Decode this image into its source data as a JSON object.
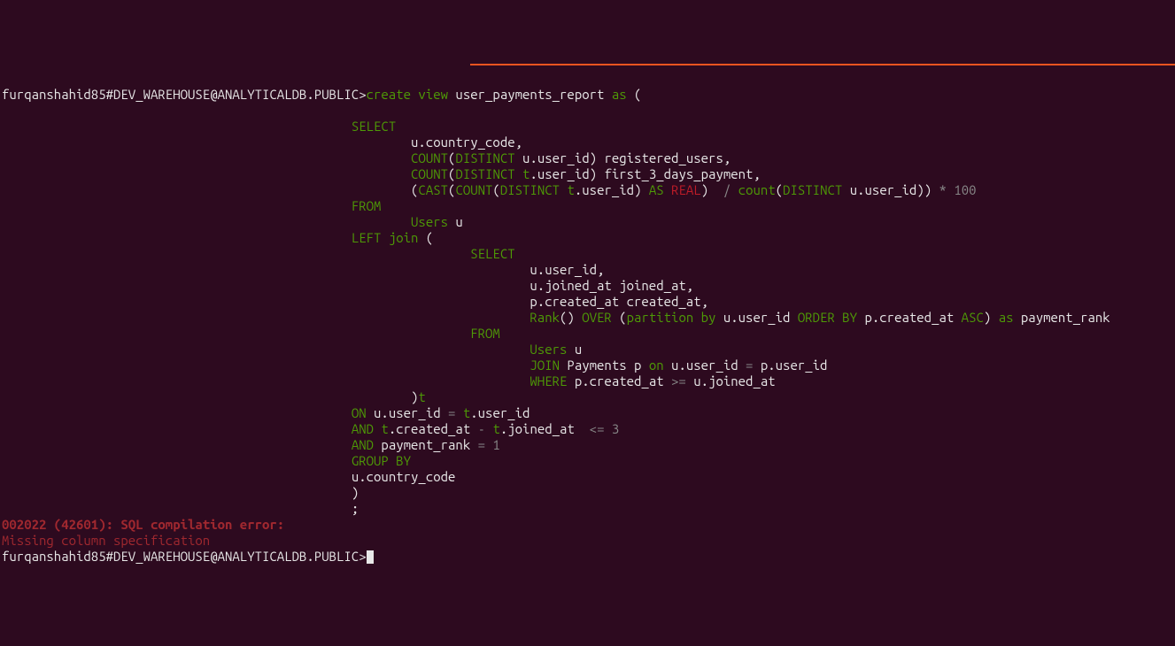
{
  "terminal": {
    "prompt": "furqanshahid85#DEV_WAREHOUSE@ANALYTICALDB.PUBLIC>",
    "prompt2": "furqanshahid85#DEV_WAREHOUSE@ANALYTICALDB.PUBLIC>",
    "sql": {
      "l1_kw": "create view",
      "l1_ident": " user_payments_report ",
      "l1_as": "as",
      "l1_paren": " (",
      "l3_select": "SELECT",
      "l4": "u.country_code,",
      "l5_count": "COUNT",
      "l5_p1": "(",
      "l5_dist": "DISTINCT",
      "l5_rest": " u.user_id) registered_users,",
      "l6_count": "COUNT",
      "l6_p1": "(",
      "l6_dist": "DISTINCT",
      "l6_t": " t",
      "l6_rest": ".user_id) first_3_days_payment,",
      "l7_p1": "(",
      "l7_cast": "CAST",
      "l7_p2": "(",
      "l7_count": "COUNT",
      "l7_p3": "(",
      "l7_dist": "DISTINCT",
      "l7_t": " t",
      "l7_uid": ".user_id)",
      "l7_as": " AS",
      "l7_real": " REAL",
      "l7_close": ")  ",
      "l7_div": "/",
      "l7_count2": " count",
      "l7_p4": "(",
      "l7_dist2": "DISTINCT",
      "l7_rest": " u.user_id)) ",
      "l7_mul": "*",
      "l7_num": " 100",
      "l8_from": "FROM",
      "l9_users": "Users",
      "l9_u": " u",
      "l10_left": "LEFT",
      "l10_join": " join",
      "l10_paren": " (",
      "l11_select": "SELECT",
      "l12": "u.user_id,",
      "l13": "u.joined_at joined_at,",
      "l14": "p.created_at created_at,",
      "l15_rank": "Rank",
      "l15_p1": "() ",
      "l15_over": "OVER",
      "l15_p2": " (",
      "l15_part": "partition by",
      "l15_uid": " u.user_id ",
      "l15_order": "ORDER BY",
      "l15_pc": " p.created_at ",
      "l15_asc": "ASC",
      "l15_close": ") ",
      "l15_as": "as",
      "l15_pr": " payment_rank",
      "l16_from": "FROM",
      "l17_users": "Users",
      "l17_u": " u",
      "l18_join": "JOIN",
      "l18_pay": " Payments p ",
      "l18_on": "on",
      "l18_cond": " u.user_id ",
      "l18_eq": "=",
      "l18_cond2": " p.user_id",
      "l19_where": "WHERE",
      "l19_p": " p.created_at ",
      "l19_ge": ">=",
      "l19_u": " u.joined_at",
      "l20_close": ")",
      "l20_t": "t",
      "l21_on": "ON",
      "l21_u": " u.user_id ",
      "l21_eq": "=",
      "l21_t": " t",
      "l21_uid": ".user_id",
      "l22_and": "AND",
      "l22_t1": " t",
      "l22_ca": ".created_at ",
      "l22_minus": "-",
      "l22_t2": " t",
      "l22_ja": ".joined_at  ",
      "l22_le": "<=",
      "l22_3": " 3",
      "l23_and": "AND",
      "l23_pr": " payment_rank ",
      "l23_eq": "=",
      "l23_1": " 1",
      "l24_group": "GROUP BY",
      "l25": "u.country_code",
      "l26": ")",
      "l27": ";"
    },
    "error": {
      "line1": "002022 (42601): SQL compilation error:",
      "line2": "Missing column specification"
    }
  }
}
